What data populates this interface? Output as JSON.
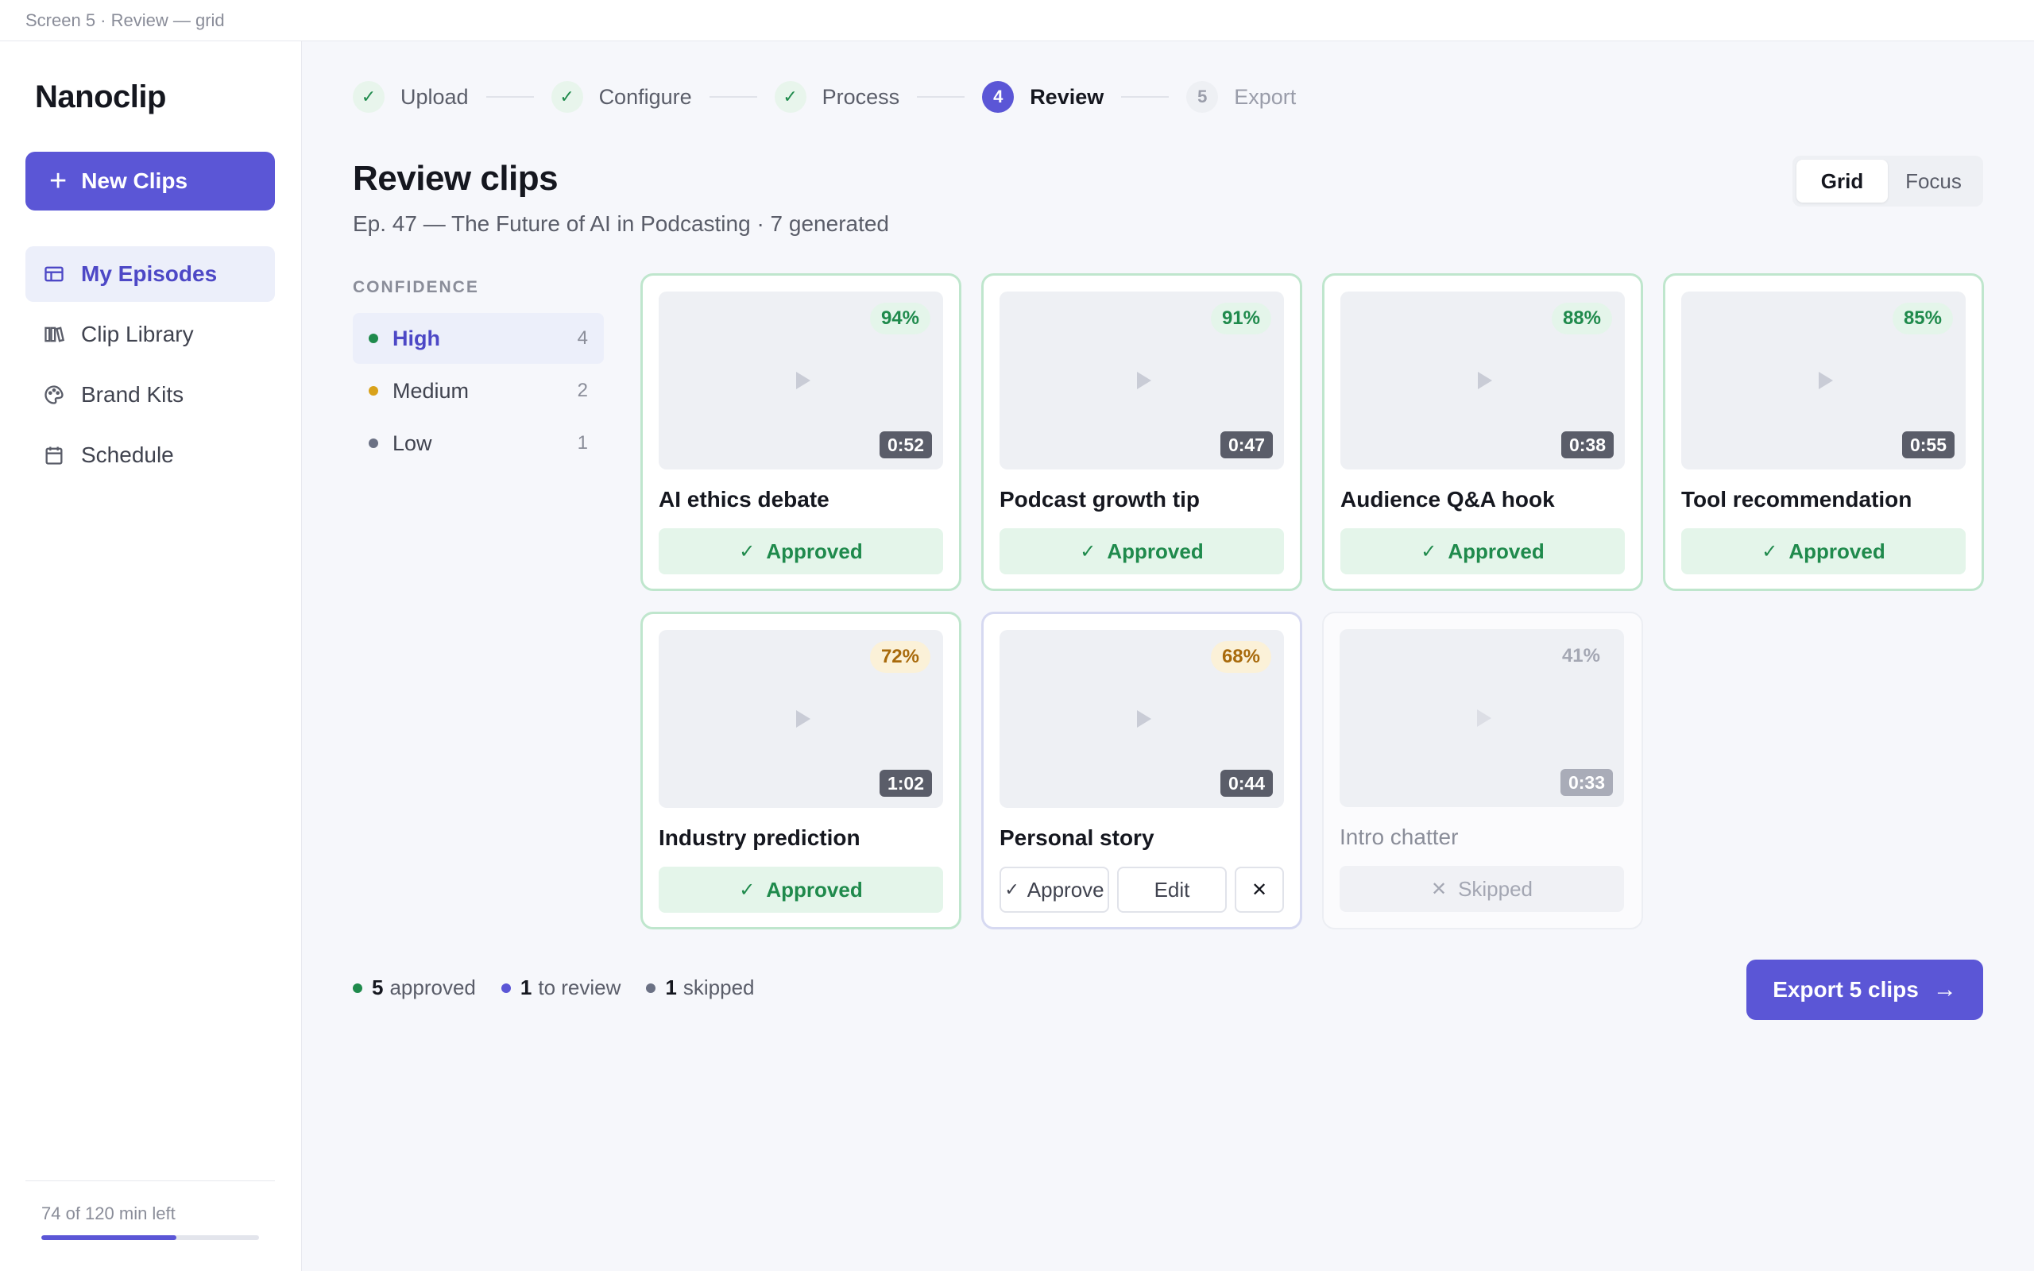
{
  "window": {
    "label": "Screen 5 · Review — grid"
  },
  "sidebar": {
    "brand": "Nanoclip",
    "new_button": "New Clips",
    "items": [
      {
        "label": "My Episodes",
        "icon": "table-icon",
        "active": true
      },
      {
        "label": "Clip Library",
        "icon": "library-icon",
        "active": false
      },
      {
        "label": "Brand Kits",
        "icon": "palette-icon",
        "active": false
      },
      {
        "label": "Schedule",
        "icon": "calendar-icon",
        "active": false
      }
    ],
    "quota": {
      "text": "74 of 120 min left",
      "used_fraction": 0.62
    }
  },
  "stepper": {
    "steps": [
      {
        "label": "Upload",
        "marker": "✓",
        "state": "done"
      },
      {
        "label": "Configure",
        "marker": "✓",
        "state": "done"
      },
      {
        "label": "Process",
        "marker": "✓",
        "state": "done"
      },
      {
        "label": "Review",
        "marker": "4",
        "state": "current"
      },
      {
        "label": "Export",
        "marker": "5",
        "state": "future"
      }
    ]
  },
  "header": {
    "title": "Review clips",
    "subtitle": "Ep. 47 — The Future of AI in Podcasting · 7 generated",
    "view_options": [
      "Grid",
      "Focus"
    ],
    "view_selected": "Grid"
  },
  "filters": {
    "heading": "CONFIDENCE",
    "items": [
      {
        "label": "High",
        "count": "4",
        "color": "#1f8a4c",
        "active": true
      },
      {
        "label": "Medium",
        "count": "2",
        "color": "#d9a21b",
        "active": false
      },
      {
        "label": "Low",
        "count": "1",
        "color": "#6b7184",
        "active": false
      }
    ]
  },
  "clips": [
    {
      "title": "AI ethics debate",
      "confidence": "94%",
      "duration": "0:52",
      "level": "high",
      "status": "Approved"
    },
    {
      "title": "Podcast growth tip",
      "confidence": "91%",
      "duration": "0:47",
      "level": "high",
      "status": "Approved"
    },
    {
      "title": "Audience Q&A hook",
      "confidence": "88%",
      "duration": "0:38",
      "level": "high",
      "status": "Approved"
    },
    {
      "title": "Tool recommendation",
      "confidence": "85%",
      "duration": "0:55",
      "level": "high",
      "status": "Approved"
    },
    {
      "title": "Industry prediction",
      "confidence": "72%",
      "duration": "1:02",
      "level": "med",
      "status": "Approved"
    },
    {
      "title": "Personal story",
      "confidence": "68%",
      "duration": "0:44",
      "level": "med",
      "status": "Review",
      "actions": {
        "approve": "Approve",
        "edit": "Edit",
        "reject": "✕"
      }
    },
    {
      "title": "Intro chatter",
      "confidence": "41%",
      "duration": "0:33",
      "level": "low",
      "status": "Skipped"
    }
  ],
  "summary": {
    "approved_count": "5",
    "approved_label": "approved",
    "approved_color": "#1f8a4c",
    "review_count": "1",
    "review_label": "to review",
    "review_color": "#5b56d6",
    "skipped_count": "1",
    "skipped_label": "skipped",
    "skipped_color": "#6b7184"
  },
  "export_button": "Export 5 clips",
  "colors": {
    "accent": "#5b56d6",
    "success": "#1f8a4c",
    "warning": "#a86a0c"
  }
}
